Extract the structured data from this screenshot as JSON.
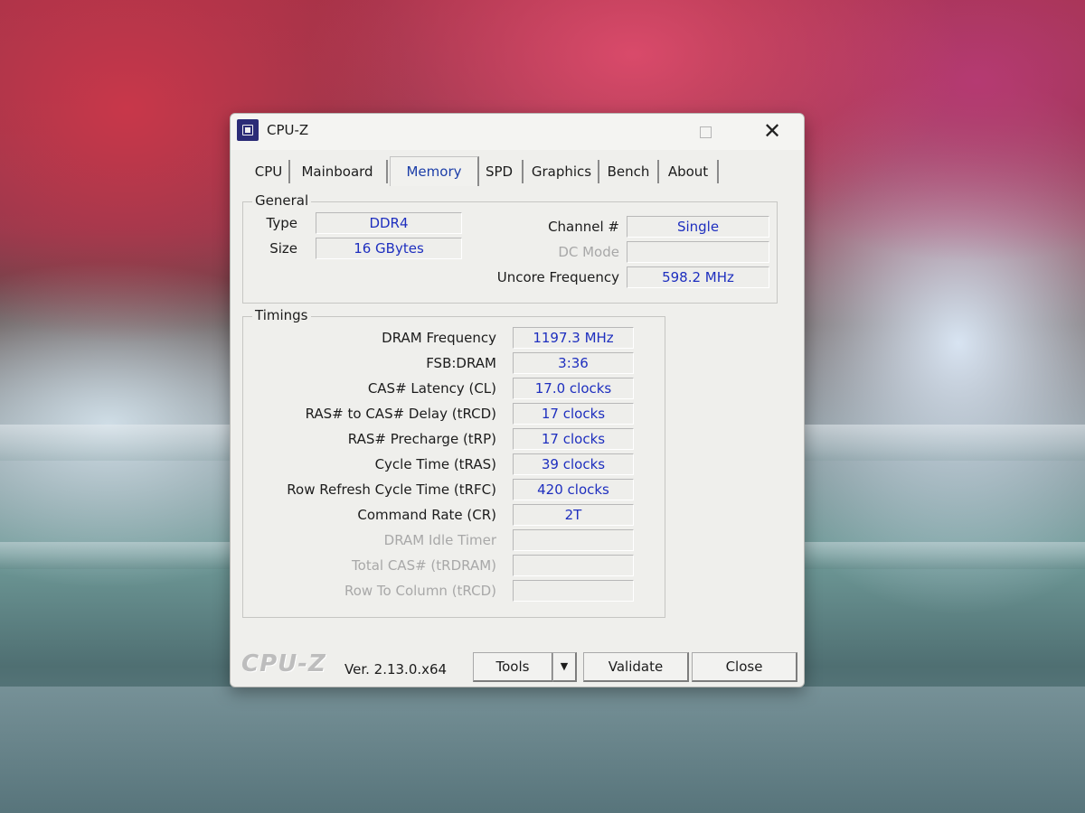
{
  "window": {
    "title": "CPU-Z"
  },
  "tabs": [
    "CPU",
    "Mainboard",
    "Memory",
    "SPD",
    "Graphics",
    "Bench",
    "About"
  ],
  "active_tab": "Memory",
  "general": {
    "legend": "General",
    "type_label": "Type",
    "type_value": "DDR4",
    "size_label": "Size",
    "size_value": "16 GBytes",
    "channel_label": "Channel #",
    "channel_value": "Single",
    "dc_mode_label": "DC Mode",
    "dc_mode_value": "",
    "uncore_label": "Uncore Frequency",
    "uncore_value": "598.2 MHz"
  },
  "timings": {
    "legend": "Timings",
    "rows": [
      {
        "label": "DRAM Frequency",
        "value": "1197.3 MHz",
        "enabled": true
      },
      {
        "label": "FSB:DRAM",
        "value": "3:36",
        "enabled": true
      },
      {
        "label": "CAS# Latency (CL)",
        "value": "17.0 clocks",
        "enabled": true
      },
      {
        "label": "RAS# to CAS# Delay (tRCD)",
        "value": "17 clocks",
        "enabled": true
      },
      {
        "label": "RAS# Precharge (tRP)",
        "value": "17 clocks",
        "enabled": true
      },
      {
        "label": "Cycle Time (tRAS)",
        "value": "39 clocks",
        "enabled": true
      },
      {
        "label": "Row Refresh Cycle Time (tRFC)",
        "value": "420 clocks",
        "enabled": true
      },
      {
        "label": "Command Rate (CR)",
        "value": "2T",
        "enabled": true
      },
      {
        "label": "DRAM Idle Timer",
        "value": "",
        "enabled": false
      },
      {
        "label": "Total CAS# (tRDRAM)",
        "value": "",
        "enabled": false
      },
      {
        "label": "Row To Column (tRCD)",
        "value": "",
        "enabled": false
      }
    ]
  },
  "footer": {
    "logo": "CPU-Z",
    "version": "Ver. 2.13.0.x64",
    "tools_label": "Tools",
    "tools_arrow": "▼",
    "validate_label": "Validate",
    "close_label": "Close"
  }
}
